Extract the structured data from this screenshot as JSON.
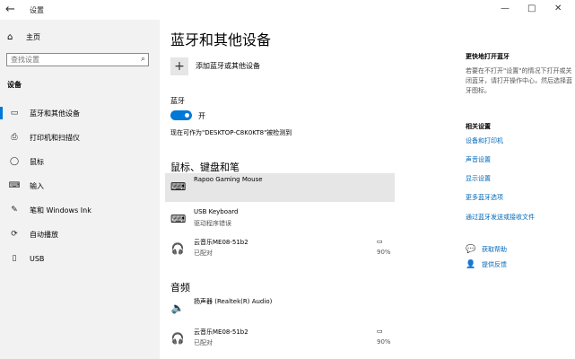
{
  "window": {
    "title": "设置",
    "back_icon": "arrow-left-icon",
    "controls": [
      "—",
      "□",
      "✕"
    ]
  },
  "sidebar": {
    "home": {
      "icon": "home-icon",
      "label": "主页"
    },
    "search": {
      "placeholder": "查找设置"
    },
    "section": "设备",
    "items": [
      {
        "icon": "monitor-icon",
        "label": "蓝牙和其他设备",
        "active": true
      },
      {
        "icon": "printer-icon",
        "label": "打印机和扫描仪"
      },
      {
        "icon": "mouse-icon",
        "label": "鼠标"
      },
      {
        "icon": "keyboard-icon",
        "label": "输入"
      },
      {
        "icon": "pen-icon",
        "label": "笔和 Windows Ink"
      },
      {
        "icon": "autoplay-icon",
        "label": "自动播放"
      },
      {
        "icon": "usb-icon",
        "label": "USB"
      }
    ]
  },
  "main": {
    "title": "蓝牙和其他设备",
    "add_device": "添加蓝牙或其他设备",
    "bluetooth_label": "蓝牙",
    "toggle_state": "开",
    "discoverable": "现在可作为\"DESKTOP-C8K0KT8\"被检测到",
    "sections": [
      {
        "title": "鼠标、键盘和笔",
        "devices": [
          {
            "icon": "keyboard-icon",
            "name": "Rapoo Gaming Mouse",
            "sub": "",
            "selected": true
          },
          {
            "icon": "keyboard-icon",
            "name": "USB Keyboard",
            "sub": "驱动程序错误"
          },
          {
            "icon": "headset-icon",
            "name": "云音乐ME08-51b2",
            "sub": "已配对",
            "battery_icon": "battery-icon",
            "battery": "90%"
          }
        ]
      },
      {
        "title": "音频",
        "devices": [
          {
            "icon": "speaker-icon",
            "name": "扬声器 (Realtek(R) Audio)",
            "sub": ""
          },
          {
            "icon": "headset-icon",
            "name": "云音乐ME08-51b2",
            "sub": "已配对",
            "battery_icon": "battery-icon",
            "battery": "90%"
          }
        ]
      }
    ]
  },
  "right": {
    "quick_title": "更快地打开蓝牙",
    "quick_desc": "若要在不打开\"设置\"的情况下打开或关闭蓝牙，请打开操作中心，然后选择蓝牙图标。",
    "related_title": "相关设置",
    "related_links": [
      "设备和打印机",
      "声音设置",
      "显示设置",
      "更多蓝牙选项",
      "通过蓝牙发送或接收文件"
    ],
    "help": [
      {
        "icon": "chat-help-icon",
        "label": "获取帮助"
      },
      {
        "icon": "feedback-icon",
        "label": "提供反馈"
      }
    ]
  }
}
